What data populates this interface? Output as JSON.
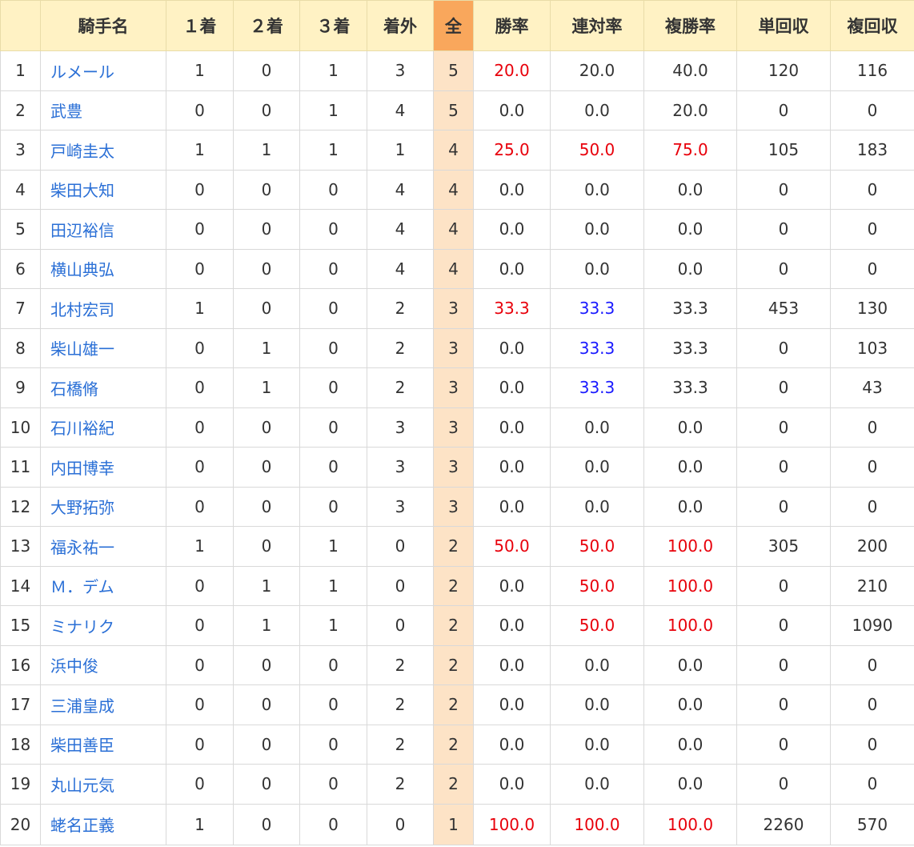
{
  "table": {
    "headers": {
      "rank": "",
      "name": "騎手名",
      "first": "１着",
      "second": "２着",
      "third": "３着",
      "out": "着外",
      "total": "全",
      "win_rate": "勝率",
      "quinella_rate": "連対率",
      "place_rate": "複勝率",
      "win_return": "単回収",
      "place_return": "複回収"
    },
    "rows": [
      {
        "rank": "1",
        "name": "ルメール",
        "first": "1",
        "second": "0",
        "third": "1",
        "out": "3",
        "total": "5",
        "win_rate": "20.0",
        "quinella_rate": "20.0",
        "place_rate": "40.0",
        "win_return": "120",
        "place_return": "116",
        "win_rate_color": "red",
        "quinella_rate_color": "",
        "place_rate_color": ""
      },
      {
        "rank": "2",
        "name": "武豊",
        "first": "0",
        "second": "0",
        "third": "1",
        "out": "4",
        "total": "5",
        "win_rate": "0.0",
        "quinella_rate": "0.0",
        "place_rate": "20.0",
        "win_return": "0",
        "place_return": "0",
        "win_rate_color": "",
        "quinella_rate_color": "",
        "place_rate_color": ""
      },
      {
        "rank": "3",
        "name": "戸崎圭太",
        "first": "1",
        "second": "1",
        "third": "1",
        "out": "1",
        "total": "4",
        "win_rate": "25.0",
        "quinella_rate": "50.0",
        "place_rate": "75.0",
        "win_return": "105",
        "place_return": "183",
        "win_rate_color": "red",
        "quinella_rate_color": "red",
        "place_rate_color": "red"
      },
      {
        "rank": "4",
        "name": "柴田大知",
        "first": "0",
        "second": "0",
        "third": "0",
        "out": "4",
        "total": "4",
        "win_rate": "0.0",
        "quinella_rate": "0.0",
        "place_rate": "0.0",
        "win_return": "0",
        "place_return": "0",
        "win_rate_color": "",
        "quinella_rate_color": "",
        "place_rate_color": ""
      },
      {
        "rank": "5",
        "name": "田辺裕信",
        "first": "0",
        "second": "0",
        "third": "0",
        "out": "4",
        "total": "4",
        "win_rate": "0.0",
        "quinella_rate": "0.0",
        "place_rate": "0.0",
        "win_return": "0",
        "place_return": "0",
        "win_rate_color": "",
        "quinella_rate_color": "",
        "place_rate_color": ""
      },
      {
        "rank": "6",
        "name": "横山典弘",
        "first": "0",
        "second": "0",
        "third": "0",
        "out": "4",
        "total": "4",
        "win_rate": "0.0",
        "quinella_rate": "0.0",
        "place_rate": "0.0",
        "win_return": "0",
        "place_return": "0",
        "win_rate_color": "",
        "quinella_rate_color": "",
        "place_rate_color": ""
      },
      {
        "rank": "7",
        "name": "北村宏司",
        "first": "1",
        "second": "0",
        "third": "0",
        "out": "2",
        "total": "3",
        "win_rate": "33.3",
        "quinella_rate": "33.3",
        "place_rate": "33.3",
        "win_return": "453",
        "place_return": "130",
        "win_rate_color": "red",
        "quinella_rate_color": "blue",
        "place_rate_color": ""
      },
      {
        "rank": "8",
        "name": "柴山雄一",
        "first": "0",
        "second": "1",
        "third": "0",
        "out": "2",
        "total": "3",
        "win_rate": "0.0",
        "quinella_rate": "33.3",
        "place_rate": "33.3",
        "win_return": "0",
        "place_return": "103",
        "win_rate_color": "",
        "quinella_rate_color": "blue",
        "place_rate_color": ""
      },
      {
        "rank": "9",
        "name": "石橋脩",
        "first": "0",
        "second": "1",
        "third": "0",
        "out": "2",
        "total": "3",
        "win_rate": "0.0",
        "quinella_rate": "33.3",
        "place_rate": "33.3",
        "win_return": "0",
        "place_return": "43",
        "win_rate_color": "",
        "quinella_rate_color": "blue",
        "place_rate_color": ""
      },
      {
        "rank": "10",
        "name": "石川裕紀",
        "first": "0",
        "second": "0",
        "third": "0",
        "out": "3",
        "total": "3",
        "win_rate": "0.0",
        "quinella_rate": "0.0",
        "place_rate": "0.0",
        "win_return": "0",
        "place_return": "0",
        "win_rate_color": "",
        "quinella_rate_color": "",
        "place_rate_color": ""
      },
      {
        "rank": "11",
        "name": "内田博幸",
        "first": "0",
        "second": "0",
        "third": "0",
        "out": "3",
        "total": "3",
        "win_rate": "0.0",
        "quinella_rate": "0.0",
        "place_rate": "0.0",
        "win_return": "0",
        "place_return": "0",
        "win_rate_color": "",
        "quinella_rate_color": "",
        "place_rate_color": ""
      },
      {
        "rank": "12",
        "name": "大野拓弥",
        "first": "0",
        "second": "0",
        "third": "0",
        "out": "3",
        "total": "3",
        "win_rate": "0.0",
        "quinella_rate": "0.0",
        "place_rate": "0.0",
        "win_return": "0",
        "place_return": "0",
        "win_rate_color": "",
        "quinella_rate_color": "",
        "place_rate_color": ""
      },
      {
        "rank": "13",
        "name": "福永祐一",
        "first": "1",
        "second": "0",
        "third": "1",
        "out": "0",
        "total": "2",
        "win_rate": "50.0",
        "quinella_rate": "50.0",
        "place_rate": "100.0",
        "win_return": "305",
        "place_return": "200",
        "win_rate_color": "red",
        "quinella_rate_color": "red",
        "place_rate_color": "red"
      },
      {
        "rank": "14",
        "name": "Ｍ．デム",
        "first": "0",
        "second": "1",
        "third": "1",
        "out": "0",
        "total": "2",
        "win_rate": "0.0",
        "quinella_rate": "50.0",
        "place_rate": "100.0",
        "win_return": "0",
        "place_return": "210",
        "win_rate_color": "",
        "quinella_rate_color": "red",
        "place_rate_color": "red"
      },
      {
        "rank": "15",
        "name": "ミナリク",
        "first": "0",
        "second": "1",
        "third": "1",
        "out": "0",
        "total": "2",
        "win_rate": "0.0",
        "quinella_rate": "50.0",
        "place_rate": "100.0",
        "win_return": "0",
        "place_return": "1090",
        "win_rate_color": "",
        "quinella_rate_color": "red",
        "place_rate_color": "red"
      },
      {
        "rank": "16",
        "name": "浜中俊",
        "first": "0",
        "second": "0",
        "third": "0",
        "out": "2",
        "total": "2",
        "win_rate": "0.0",
        "quinella_rate": "0.0",
        "place_rate": "0.0",
        "win_return": "0",
        "place_return": "0",
        "win_rate_color": "",
        "quinella_rate_color": "",
        "place_rate_color": ""
      },
      {
        "rank": "17",
        "name": "三浦皇成",
        "first": "0",
        "second": "0",
        "third": "0",
        "out": "2",
        "total": "2",
        "win_rate": "0.0",
        "quinella_rate": "0.0",
        "place_rate": "0.0",
        "win_return": "0",
        "place_return": "0",
        "win_rate_color": "",
        "quinella_rate_color": "",
        "place_rate_color": ""
      },
      {
        "rank": "18",
        "name": "柴田善臣",
        "first": "0",
        "second": "0",
        "third": "0",
        "out": "2",
        "total": "2",
        "win_rate": "0.0",
        "quinella_rate": "0.0",
        "place_rate": "0.0",
        "win_return": "0",
        "place_return": "0",
        "win_rate_color": "",
        "quinella_rate_color": "",
        "place_rate_color": ""
      },
      {
        "rank": "19",
        "name": "丸山元気",
        "first": "0",
        "second": "0",
        "third": "0",
        "out": "2",
        "total": "2",
        "win_rate": "0.0",
        "quinella_rate": "0.0",
        "place_rate": "0.0",
        "win_return": "0",
        "place_return": "0",
        "win_rate_color": "",
        "quinella_rate_color": "",
        "place_rate_color": ""
      },
      {
        "rank": "20",
        "name": "蛯名正義",
        "first": "1",
        "second": "0",
        "third": "0",
        "out": "0",
        "total": "1",
        "win_rate": "100.0",
        "quinella_rate": "100.0",
        "place_rate": "100.0",
        "win_return": "2260",
        "place_return": "570",
        "win_rate_color": "red",
        "quinella_rate_color": "red",
        "place_rate_color": "red"
      }
    ]
  },
  "colors": {
    "header_bg": "#fff2c4",
    "total_header_bg": "#f9a75c",
    "total_column_bg": "#fde3c6",
    "link": "#2a6fd6",
    "red": "#e8000b",
    "blue": "#1a1aff"
  }
}
